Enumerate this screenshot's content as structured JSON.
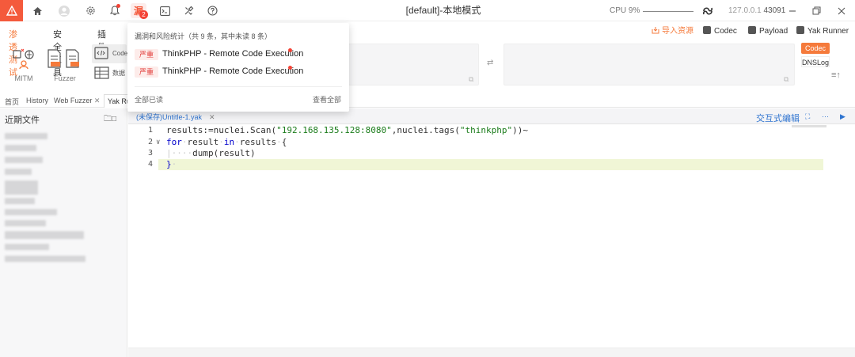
{
  "titlebar": {
    "window_title": "[default]-本地模式",
    "cpu_label": "CPU 9%",
    "ip": "127.0.0.1",
    "port": "43091",
    "notif_count": "2",
    "icons": [
      "home-icon",
      "user-icon",
      "settings-icon",
      "bell-icon",
      "vuln-alert-icon",
      "terminal-icon",
      "tools-icon",
      "help-icon"
    ]
  },
  "ribbon": {
    "tabs": [
      "渗透测试",
      "安全工具",
      "插件"
    ],
    "active_tab": 0,
    "tools": [
      {
        "label": "MITM"
      },
      {
        "label": "Fuzzer"
      }
    ],
    "partial_labels": [
      "Codec",
      "数据"
    ]
  },
  "actions": {
    "import": "导入资源",
    "codec": "Codec",
    "payload": "Payload",
    "yak_runner": "Yak Runner"
  },
  "side_tags": {
    "codec": "Codec",
    "dnslog": "DNSLog"
  },
  "page_tabs": [
    {
      "label": "首页"
    },
    {
      "label": "History"
    },
    {
      "label": "Web Fuzzer"
    },
    {
      "label": "Yak Ru"
    }
  ],
  "left_panel": {
    "title": "近期文件"
  },
  "editor": {
    "file_tab": "(未保存)Untitle-1.yak",
    "interactive_label": "交互式编辑",
    "lines": [
      {
        "num": "1",
        "text": "results:=nuclei.Scan(\"192.168.135.128:8080\",nuclei.tags(\"thinkphp\"))~"
      },
      {
        "num": "2",
        "text": "for result in results {"
      },
      {
        "num": "3",
        "text": "dump(result)"
      },
      {
        "num": "4",
        "text": "}"
      }
    ]
  },
  "notifications": {
    "header": "漏洞和风险统计（共 9 条，其中未读 8 条）",
    "items": [
      {
        "severity": "严重",
        "title": "ThinkPHP - Remote Code Execution"
      },
      {
        "severity": "严重",
        "title": "ThinkPHP - Remote Code Execution"
      }
    ],
    "mark_all_read": "全部已读",
    "view_all": "查看全部"
  },
  "colors": {
    "accent": "#f57a3b",
    "brand": "#f45a3c",
    "link": "#2f74d0",
    "severity_bg": "#fdecea",
    "severity_fg": "#e23c39"
  }
}
